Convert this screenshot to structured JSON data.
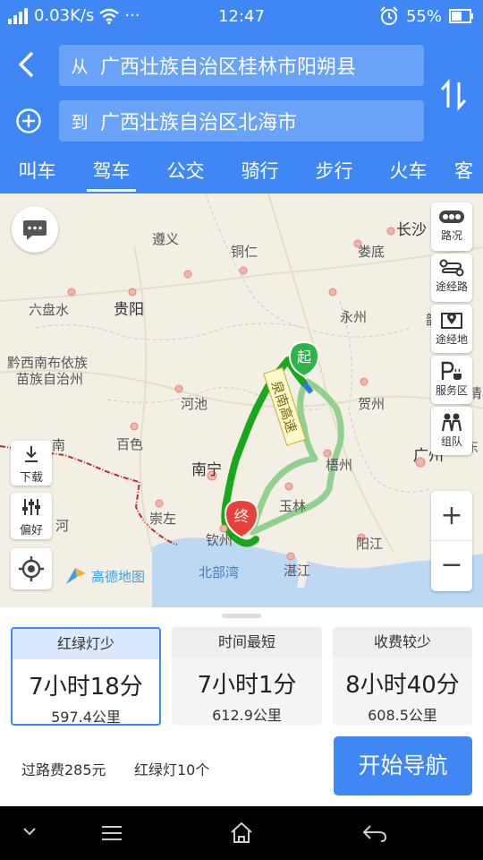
{
  "status_bar": {
    "network_speed": "0.03K/s",
    "more": "···",
    "time": "12:47",
    "battery": "55%"
  },
  "header": {
    "origin_prefix": "从",
    "origin": "广西壮族自治区桂林市阳朔县",
    "destination_prefix": "到",
    "destination": "广西壮族自治区北海市"
  },
  "tabs": [
    {
      "label": "叫车"
    },
    {
      "label": "驾车"
    },
    {
      "label": "公交"
    },
    {
      "label": "骑行"
    },
    {
      "label": "步行"
    },
    {
      "label": "火车"
    },
    {
      "label": "客"
    }
  ],
  "active_tab": "驾车",
  "map": {
    "cities": [
      "长沙",
      "遵义",
      "铜仁",
      "娄底",
      "贵阳",
      "六盘水",
      "永州",
      "黔西南布依族",
      "苗族自治州",
      "河池",
      "贺州",
      "百色",
      "梧州",
      "广州",
      "南宁",
      "玉林",
      "崇左",
      "钦州",
      "阳江",
      "湛江",
      "南",
      "河",
      "韶",
      "东",
      "清"
    ],
    "sea": "北部湾",
    "highway_label": "泉南高速",
    "start_marker": "起",
    "end_marker": "终",
    "brand": "高德地图",
    "right_tools": [
      {
        "label": "路况",
        "icon": "traffic-icon"
      },
      {
        "label": "途经路",
        "icon": "waypoint-road-icon"
      },
      {
        "label": "途经地",
        "icon": "waypoint-place-icon"
      },
      {
        "label": "服务区",
        "icon": "service-area-icon"
      },
      {
        "label": "组队",
        "icon": "team-icon"
      }
    ],
    "download_label": "下载",
    "prefs_label": "偏好",
    "zoom_in": "+",
    "zoom_out": "−"
  },
  "options": [
    {
      "head": "红绿灯少",
      "time": "7小时18分",
      "distance": "597.4公里"
    },
    {
      "head": "时间最短",
      "time": "7小时1分",
      "distance": "612.9公里"
    },
    {
      "head": "收费较少",
      "time": "8小时40分",
      "distance": "608.5公里"
    }
  ],
  "summary": {
    "toll": "过路费285元",
    "lights": "红绿灯10个"
  },
  "start_nav": "开始导航",
  "colors": {
    "primary": "#3f87f5",
    "route_main": "#19a819",
    "route_alt": "#8fd18f",
    "end_marker": "#e8403a",
    "start_marker": "#2db34a"
  }
}
